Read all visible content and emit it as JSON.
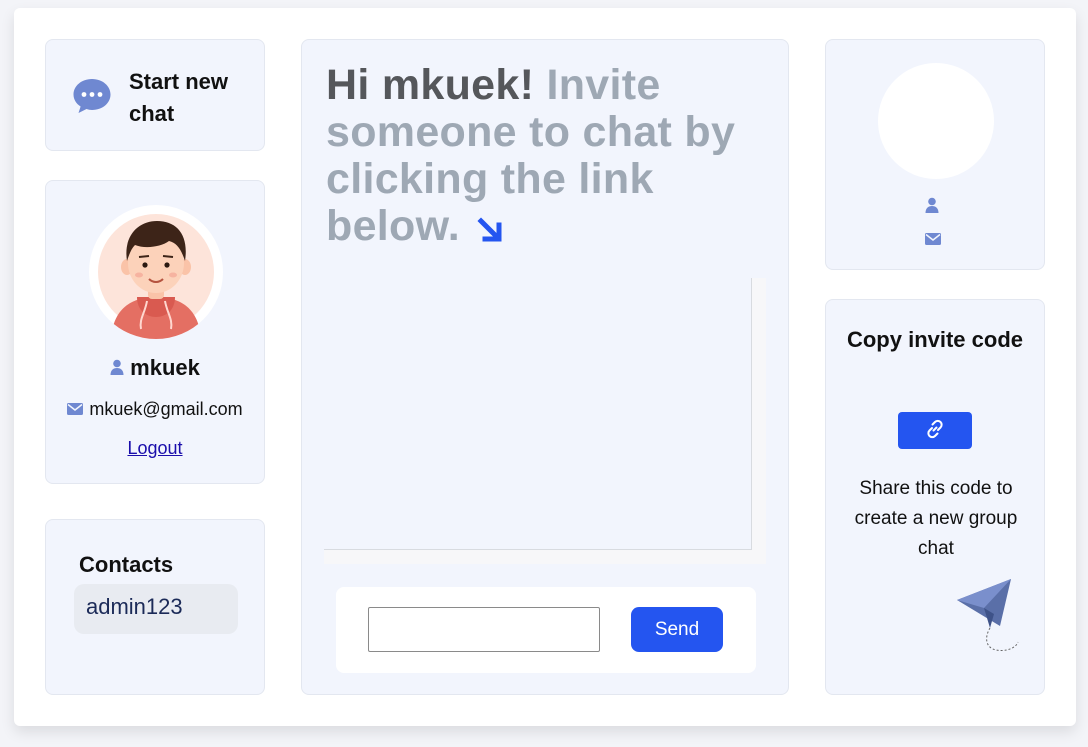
{
  "sidebar": {
    "start_chat_label": "Start new chat"
  },
  "profile": {
    "username": "mkuek",
    "email": "mkuek@gmail.com",
    "logout_label": "Logout"
  },
  "contacts": {
    "title": "Contacts",
    "items": [
      {
        "name": "admin123"
      }
    ]
  },
  "chat": {
    "greeting_hi": "Hi mkuek!",
    "greeting_invite": "Invite someone to chat by clicking the link below.",
    "message_input_value": "",
    "send_label": "Send"
  },
  "invite": {
    "title": "Copy invite code",
    "description": "Share this code to create a new group chat"
  },
  "icons": {
    "chat": "chat-bubble-icon",
    "user": "user-icon",
    "mail": "mail-icon",
    "arrow": "arrow-down-right-icon",
    "link": "link-icon",
    "plane": "paper-plane-icon"
  },
  "colors": {
    "accent": "#2455f0",
    "card_bg": "#f2f5fd",
    "icon_blue": "#6f88d1",
    "greeting_dark": "#55575b",
    "greeting_light": "#9ea8b4"
  }
}
